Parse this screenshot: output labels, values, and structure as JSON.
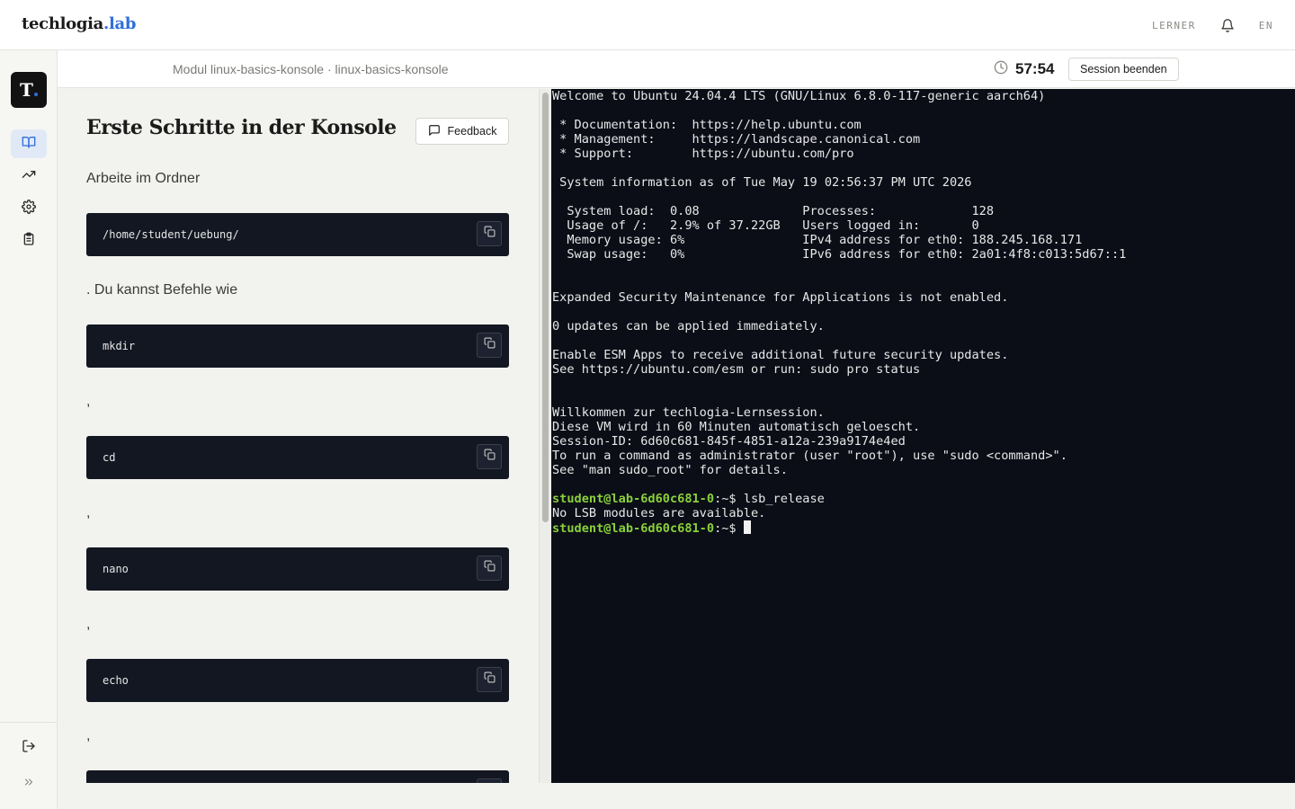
{
  "header": {
    "brand_main": "techlogia",
    "brand_accent": ".lab",
    "role": "LERNER",
    "language": "EN"
  },
  "rail": {
    "logo_letter": "T",
    "items": [
      {
        "icon": "book-open-icon",
        "active": true
      },
      {
        "icon": "trending-up-icon",
        "active": false
      },
      {
        "icon": "gear-icon",
        "active": false
      },
      {
        "icon": "clipboard-icon",
        "active": false
      }
    ],
    "bottom": [
      {
        "icon": "logout-icon"
      },
      {
        "icon": "chevrons-right-icon"
      }
    ]
  },
  "module_bar": {
    "breadcrumb": "Modul linux-basics-konsole · linux-basics-konsole",
    "timer": "57:54",
    "end_session_label": "Session beenden"
  },
  "lesson": {
    "title": "Erste Schritte in der Konsole",
    "feedback_label": "Feedback",
    "intro": "Arbeite im Ordner",
    "path_code": "/home/student/uebung/",
    "commands_intro": ". Du kannst Befehle wie",
    "commands": [
      "mkdir",
      "cd",
      "nano",
      "echo"
    ],
    "separator": ","
  },
  "terminal": {
    "lines": [
      "Welcome to Ubuntu 24.04.4 LTS (GNU/Linux 6.8.0-117-generic aarch64)",
      "",
      " * Documentation:  https://help.ubuntu.com",
      " * Management:     https://landscape.canonical.com",
      " * Support:        https://ubuntu.com/pro",
      "",
      " System information as of Tue May 19 02:56:37 PM UTC 2026",
      "",
      "  System load:  0.08              Processes:             128",
      "  Usage of /:   2.9% of 37.22GB   Users logged in:       0",
      "  Memory usage: 6%                IPv4 address for eth0: 188.245.168.171",
      "  Swap usage:   0%                IPv6 address for eth0: 2a01:4f8:c013:5d67::1",
      "",
      "",
      "Expanded Security Maintenance for Applications is not enabled.",
      "",
      "0 updates can be applied immediately.",
      "",
      "Enable ESM Apps to receive additional future security updates.",
      "See https://ubuntu.com/esm or run: sudo pro status",
      "",
      "",
      "Willkommen zur techlogia-Lernsession.",
      "Diese VM wird in 60 Minuten automatisch geloescht.",
      "Session-ID: 6d60c681-845f-4851-a12a-239a9174e4ed",
      "To run a command as administrator (user \"root\"), use \"sudo <command>\".",
      "See \"man sudo_root\" for details.",
      ""
    ],
    "prompt_user": "student@lab-6d60c681-0",
    "prompt_path": ":~$ ",
    "command_1": "lsb_release",
    "output_1": "No LSB modules are available."
  },
  "colors": {
    "accent": "#2f6fdb",
    "terminal_bg": "#0b0e17",
    "prompt_green": "#8ad13a",
    "code_bg": "#131722"
  }
}
